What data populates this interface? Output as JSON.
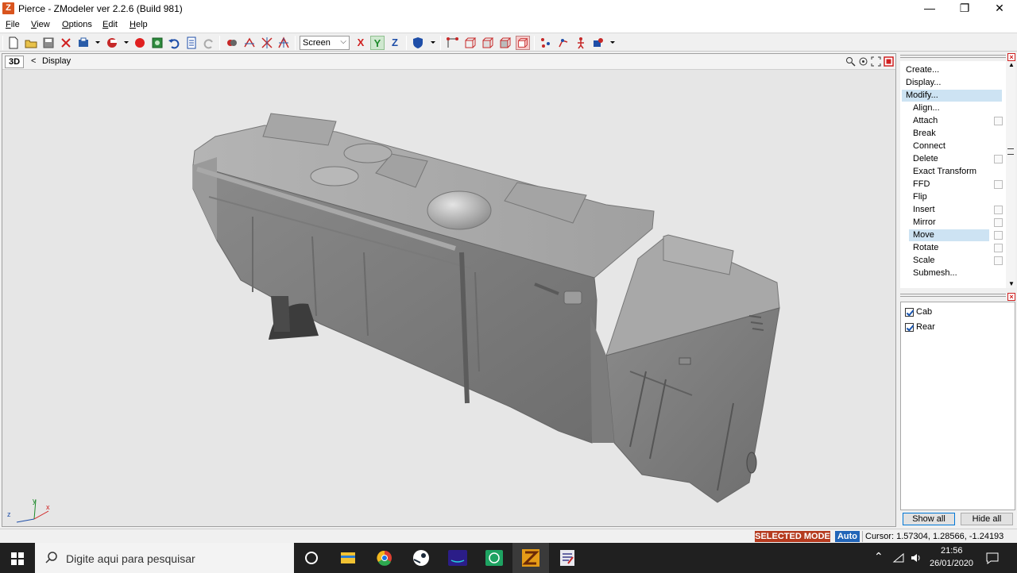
{
  "window": {
    "title": "Pierce - ZModeler ver 2.2.6 (Build 981)",
    "icon_letter": "Z",
    "controls": {
      "minimize": "—",
      "restore": "❐",
      "close": "✕"
    }
  },
  "menu": [
    "File",
    "View",
    "Options",
    "Edit",
    "Help"
  ],
  "toolbar": {
    "coordinate_system": "Screen",
    "axes": {
      "x": "X",
      "y": "Y",
      "z": "Z"
    }
  },
  "viewport": {
    "mode": "3D",
    "back_arrow": "<",
    "name": "Display",
    "axis_labels": {
      "y": "y",
      "x": "x",
      "z": "z"
    }
  },
  "commands": [
    {
      "label": "Create...",
      "indent": 0,
      "box": false,
      "selected": false
    },
    {
      "label": "Display...",
      "indent": 0,
      "box": false,
      "selected": false
    },
    {
      "label": "Modify...",
      "indent": 0,
      "box": false,
      "selected": true
    },
    {
      "label": "Align...",
      "indent": 1,
      "box": false,
      "selected": false
    },
    {
      "label": "Attach",
      "indent": 1,
      "box": true,
      "selected": false
    },
    {
      "label": "Break",
      "indent": 1,
      "box": false,
      "selected": false
    },
    {
      "label": "Connect",
      "indent": 1,
      "box": false,
      "selected": false
    },
    {
      "label": "Delete",
      "indent": 1,
      "box": true,
      "selected": false
    },
    {
      "label": "Exact Transform",
      "indent": 1,
      "box": false,
      "selected": false
    },
    {
      "label": "FFD",
      "indent": 1,
      "box": true,
      "selected": false
    },
    {
      "label": "Flip",
      "indent": 1,
      "box": false,
      "selected": false
    },
    {
      "label": "Insert",
      "indent": 1,
      "box": true,
      "selected": false
    },
    {
      "label": "Mirror",
      "indent": 1,
      "box": true,
      "selected": false
    },
    {
      "label": "Move",
      "indent": 1,
      "box": true,
      "selected": true
    },
    {
      "label": "Rotate",
      "indent": 1,
      "box": true,
      "selected": false
    },
    {
      "label": "Scale",
      "indent": 1,
      "box": true,
      "selected": false
    },
    {
      "label": "Submesh...",
      "indent": 1,
      "box": false,
      "selected": false
    }
  ],
  "objects": [
    {
      "label": "Cab",
      "checked": true
    },
    {
      "label": "Rear",
      "checked": true
    }
  ],
  "object_buttons": {
    "show_all": "Show all",
    "hide_all": "Hide all"
  },
  "status": {
    "mode": "SELECTED MODE",
    "auto": "Auto",
    "cursor": "Cursor: 1.57304, 1.28566, -1.24193"
  },
  "taskbar": {
    "search_placeholder": "Digite aqui para pesquisar",
    "time": "21:56",
    "date": "26/01/2020"
  }
}
